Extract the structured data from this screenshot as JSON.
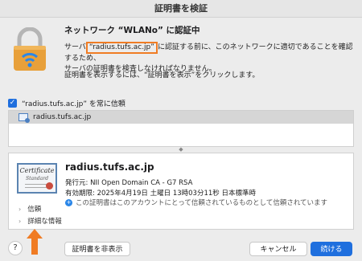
{
  "window": {
    "title": "証明書を検証"
  },
  "header": {
    "heading": "ネットワーク “WLANo” に認証中",
    "desc_prefix": "サーバ",
    "desc_highlight": "“radius.tufs.ac.jp”",
    "desc_suffix": "に認証する前に、このネットワークに適切であることを確認するため、",
    "desc_line2": "サーバの証明書を検査しなければなりません。",
    "desc2": "証明書を表示するには、“証明書を表示”をクリックします。"
  },
  "trust_option": {
    "label": "“radius.tufs.ac.jp” を常に信頼",
    "checked": true
  },
  "cert_list": {
    "items": [
      "radius.tufs.ac.jp"
    ]
  },
  "certificate": {
    "thumbnail_title": "Certificate",
    "thumbnail_subtitle": "Standard",
    "common_name": "radius.tufs.ac.jp",
    "issuer": "発行元: NII Open Domain CA - G7 RSA",
    "expiry": "有効期限: 2025年4月19日 土曜日 13時03分11秒 日本標準時",
    "trust_status": "この証明書はこのアカウントにとって信頼されているものとして信頼されています"
  },
  "disclosures": [
    {
      "label": "信頼"
    },
    {
      "label": "詳細な情報"
    }
  ],
  "buttons": {
    "help": "?",
    "hide_cert": "証明書を非表示",
    "cancel": "キャンセル",
    "continue": "続ける"
  },
  "colors": {
    "accent": "#1f6fde",
    "highlight_box": "#f07c24",
    "arrow": "#f07c24",
    "lock_body": "#e8a03a",
    "wifi": "#2a86e8"
  }
}
